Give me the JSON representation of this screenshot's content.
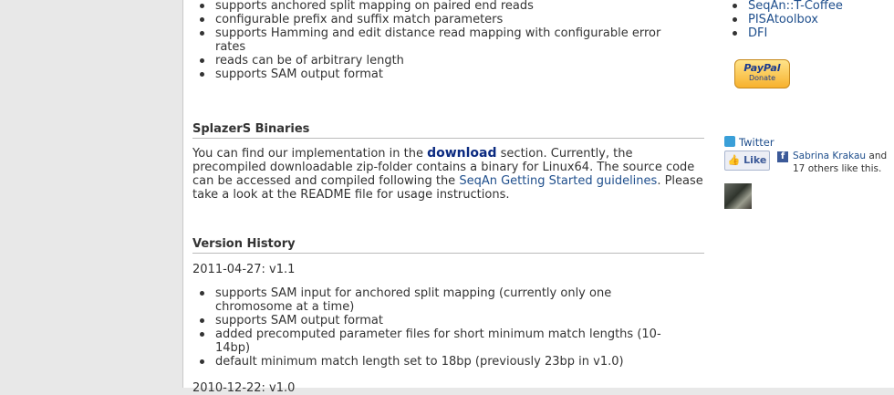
{
  "top_list": [
    "supports anchored split mapping on paired end reads",
    "configurable prefix and suffix match parameters",
    "supports Hamming and edit distance read mapping with configurable error rates",
    "reads can be of arbitrary length",
    "supports SAM output format"
  ],
  "binaries": {
    "heading": "SplazerS Binaries",
    "p1": "You can find our implementation in the ",
    "link_download": "download",
    "p2": " section. Currently, the precompiled downloadable zip-folder contains a binary for Linux64. The source code can be accessed and compiled following the ",
    "link_guide": "SeqAn Getting Started guidelines",
    "p3": ". Please take a look at the README file for usage instructions."
  },
  "history": {
    "heading": "Version History",
    "version1": "2011-04-27: v1.1",
    "items": [
      "supports SAM input for anchored split mapping (currently only one chromosome at a time)",
      "supports SAM output format",
      "added precomputed parameter files for short minimum match lengths (10-14bp)",
      "default minimum match length set to 18bp (previously 23bp in v1.0)"
    ],
    "version2": "2010-12-22: v1.0"
  },
  "sidebar": {
    "links": [
      "SeqAn::T-Coffee",
      "PISAtoolbox",
      "DFI"
    ],
    "paypal_label": "PayPal",
    "paypal_sub": "Donate",
    "twitter": "Twitter",
    "like_button": "Like",
    "fb_letter": "f",
    "like_name": "Sabrina Krakau",
    "like_rest": " and 17 others like this."
  }
}
